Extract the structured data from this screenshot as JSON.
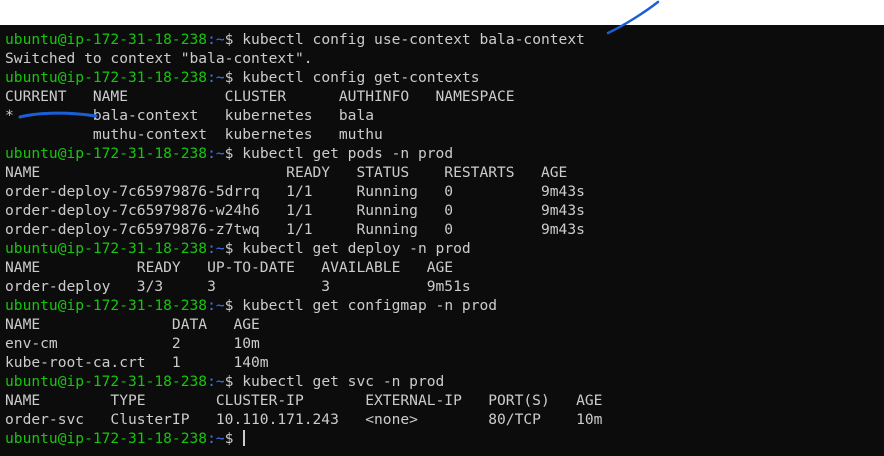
{
  "terminal": {
    "prompt_user": "ubuntu@ip-172-31-18-238",
    "prompt_path": ":~",
    "prompt_symbol": "$ ",
    "lines": [
      {
        "type": "prompt",
        "cmd": "kubectl config use-context bala-context"
      },
      {
        "type": "output",
        "text": "Switched to context \"bala-context\"."
      },
      {
        "type": "prompt",
        "cmd": "kubectl config get-contexts"
      },
      {
        "type": "output",
        "text": "CURRENT   NAME           CLUSTER      AUTHINFO   NAMESPACE"
      },
      {
        "type": "output",
        "text": "*         bala-context   kubernetes   bala"
      },
      {
        "type": "output",
        "text": "          muthu-context  kubernetes   muthu"
      },
      {
        "type": "prompt",
        "cmd": "kubectl get pods -n prod"
      },
      {
        "type": "output",
        "text": "NAME                            READY   STATUS    RESTARTS   AGE"
      },
      {
        "type": "output",
        "text": "order-deploy-7c65979876-5drrq   1/1     Running   0          9m43s"
      },
      {
        "type": "output",
        "text": "order-deploy-7c65979876-w24h6   1/1     Running   0          9m43s"
      },
      {
        "type": "output",
        "text": "order-deploy-7c65979876-z7twq   1/1     Running   0          9m43s"
      },
      {
        "type": "prompt",
        "cmd": "kubectl get deploy -n prod"
      },
      {
        "type": "output",
        "text": "NAME           READY   UP-TO-DATE   AVAILABLE   AGE"
      },
      {
        "type": "output",
        "text": "order-deploy   3/3     3            3           9m51s"
      },
      {
        "type": "prompt",
        "cmd": "kubectl get configmap -n prod"
      },
      {
        "type": "output",
        "text": "NAME               DATA   AGE"
      },
      {
        "type": "output",
        "text": "env-cm             2      10m"
      },
      {
        "type": "output",
        "text": "kube-root-ca.crt   1      140m"
      },
      {
        "type": "prompt",
        "cmd": "kubectl get svc -n prod"
      },
      {
        "type": "output",
        "text": "NAME        TYPE        CLUSTER-IP       EXTERNAL-IP   PORT(S)   AGE"
      },
      {
        "type": "output",
        "text": "order-svc   ClusterIP   10.110.171.243   <none>        80/TCP    10m"
      },
      {
        "type": "prompt",
        "cmd": "",
        "cursor": true
      }
    ]
  },
  "colors": {
    "background": "#0c0c0c",
    "foreground": "#cccccc",
    "prompt_user": "#16c60c",
    "prompt_path": "#3b78ff",
    "annotation_ink": "#1a5fd6"
  }
}
